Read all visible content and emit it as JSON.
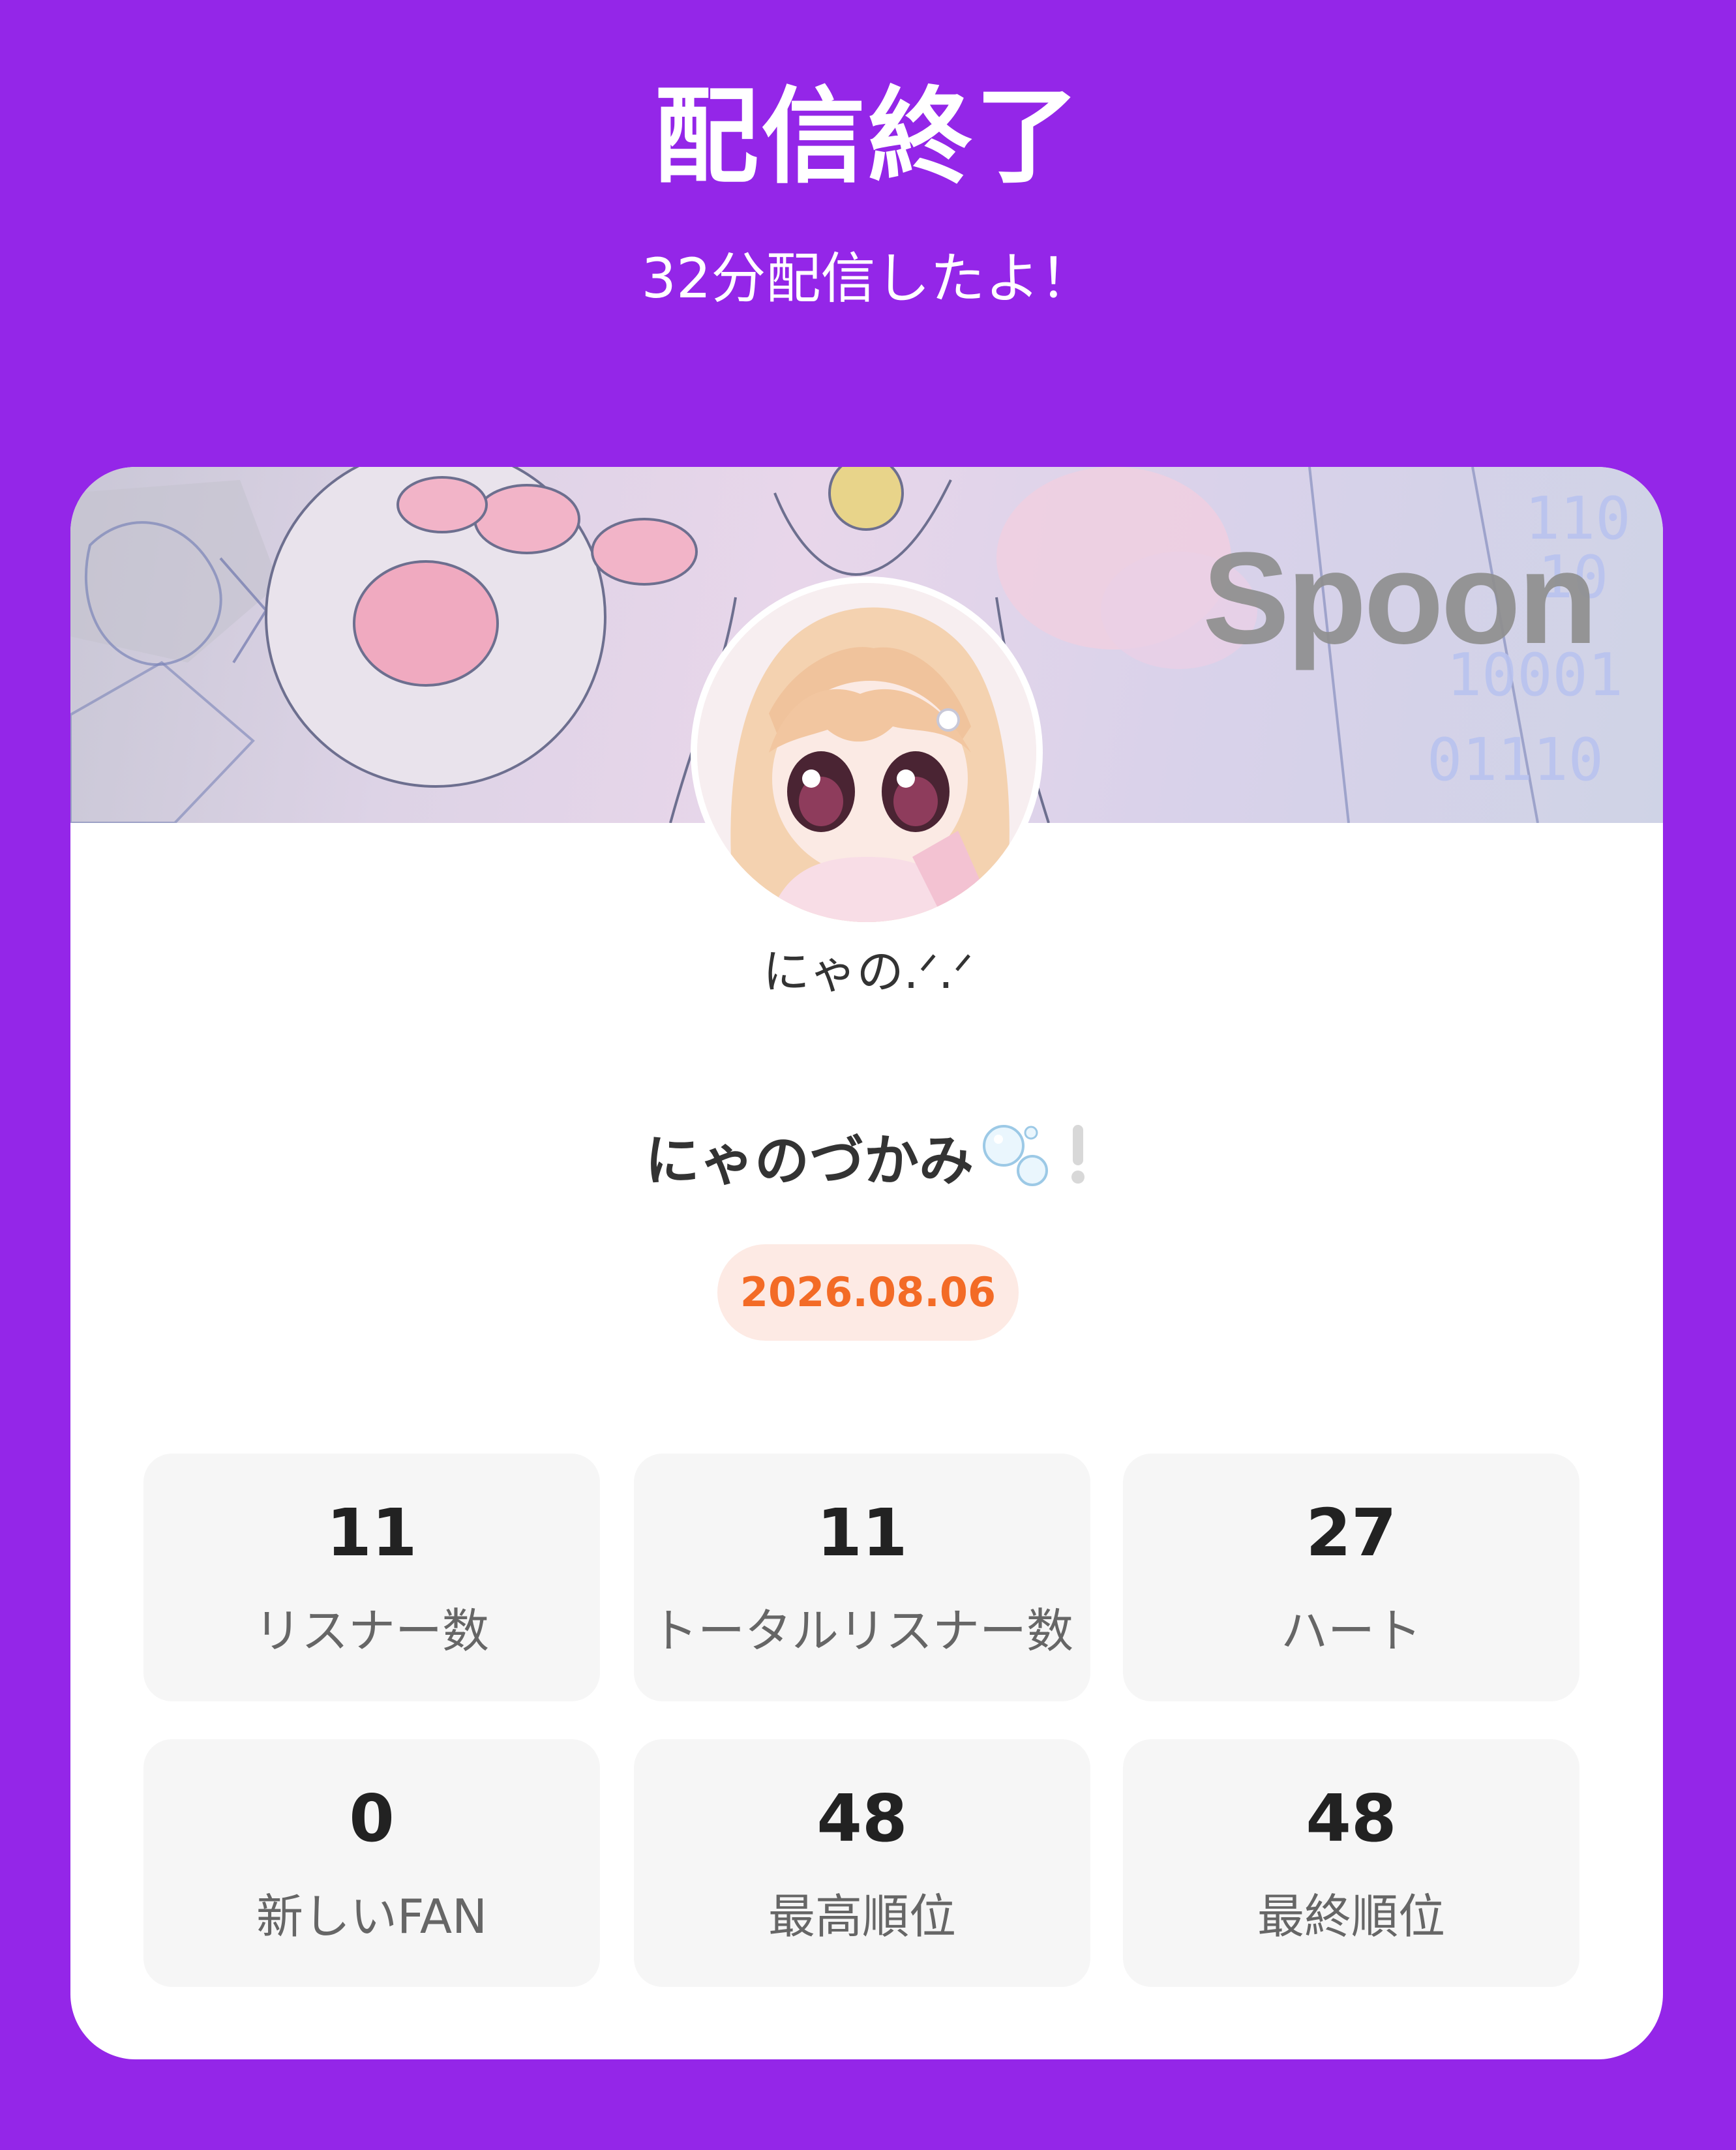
{
  "header": {
    "title": "配信終了",
    "subtitle": "32分配信したよ！"
  },
  "card": {
    "brand": "Spoon",
    "username": "にゃの.ᐟ.ᐟ",
    "stream_title": "にゃのづかみ",
    "stream_title_icons": [
      "bubbles-icon",
      "exclamation-icon"
    ],
    "date": "2026.08.06",
    "colors": {
      "background": "#9426E8",
      "date_badge_bg": "#FDEAE4",
      "date_badge_text": "#F36B26",
      "stat_tile_bg": "#F6F6F6"
    }
  },
  "stats": [
    {
      "value": "11",
      "label": "リスナー数"
    },
    {
      "value": "11",
      "label": "トータルリスナー数"
    },
    {
      "value": "27",
      "label": "ハート"
    },
    {
      "value": "0",
      "label": "新しいFAN"
    },
    {
      "value": "48",
      "label": "最高順位"
    },
    {
      "value": "48",
      "label": "最終順位"
    }
  ]
}
